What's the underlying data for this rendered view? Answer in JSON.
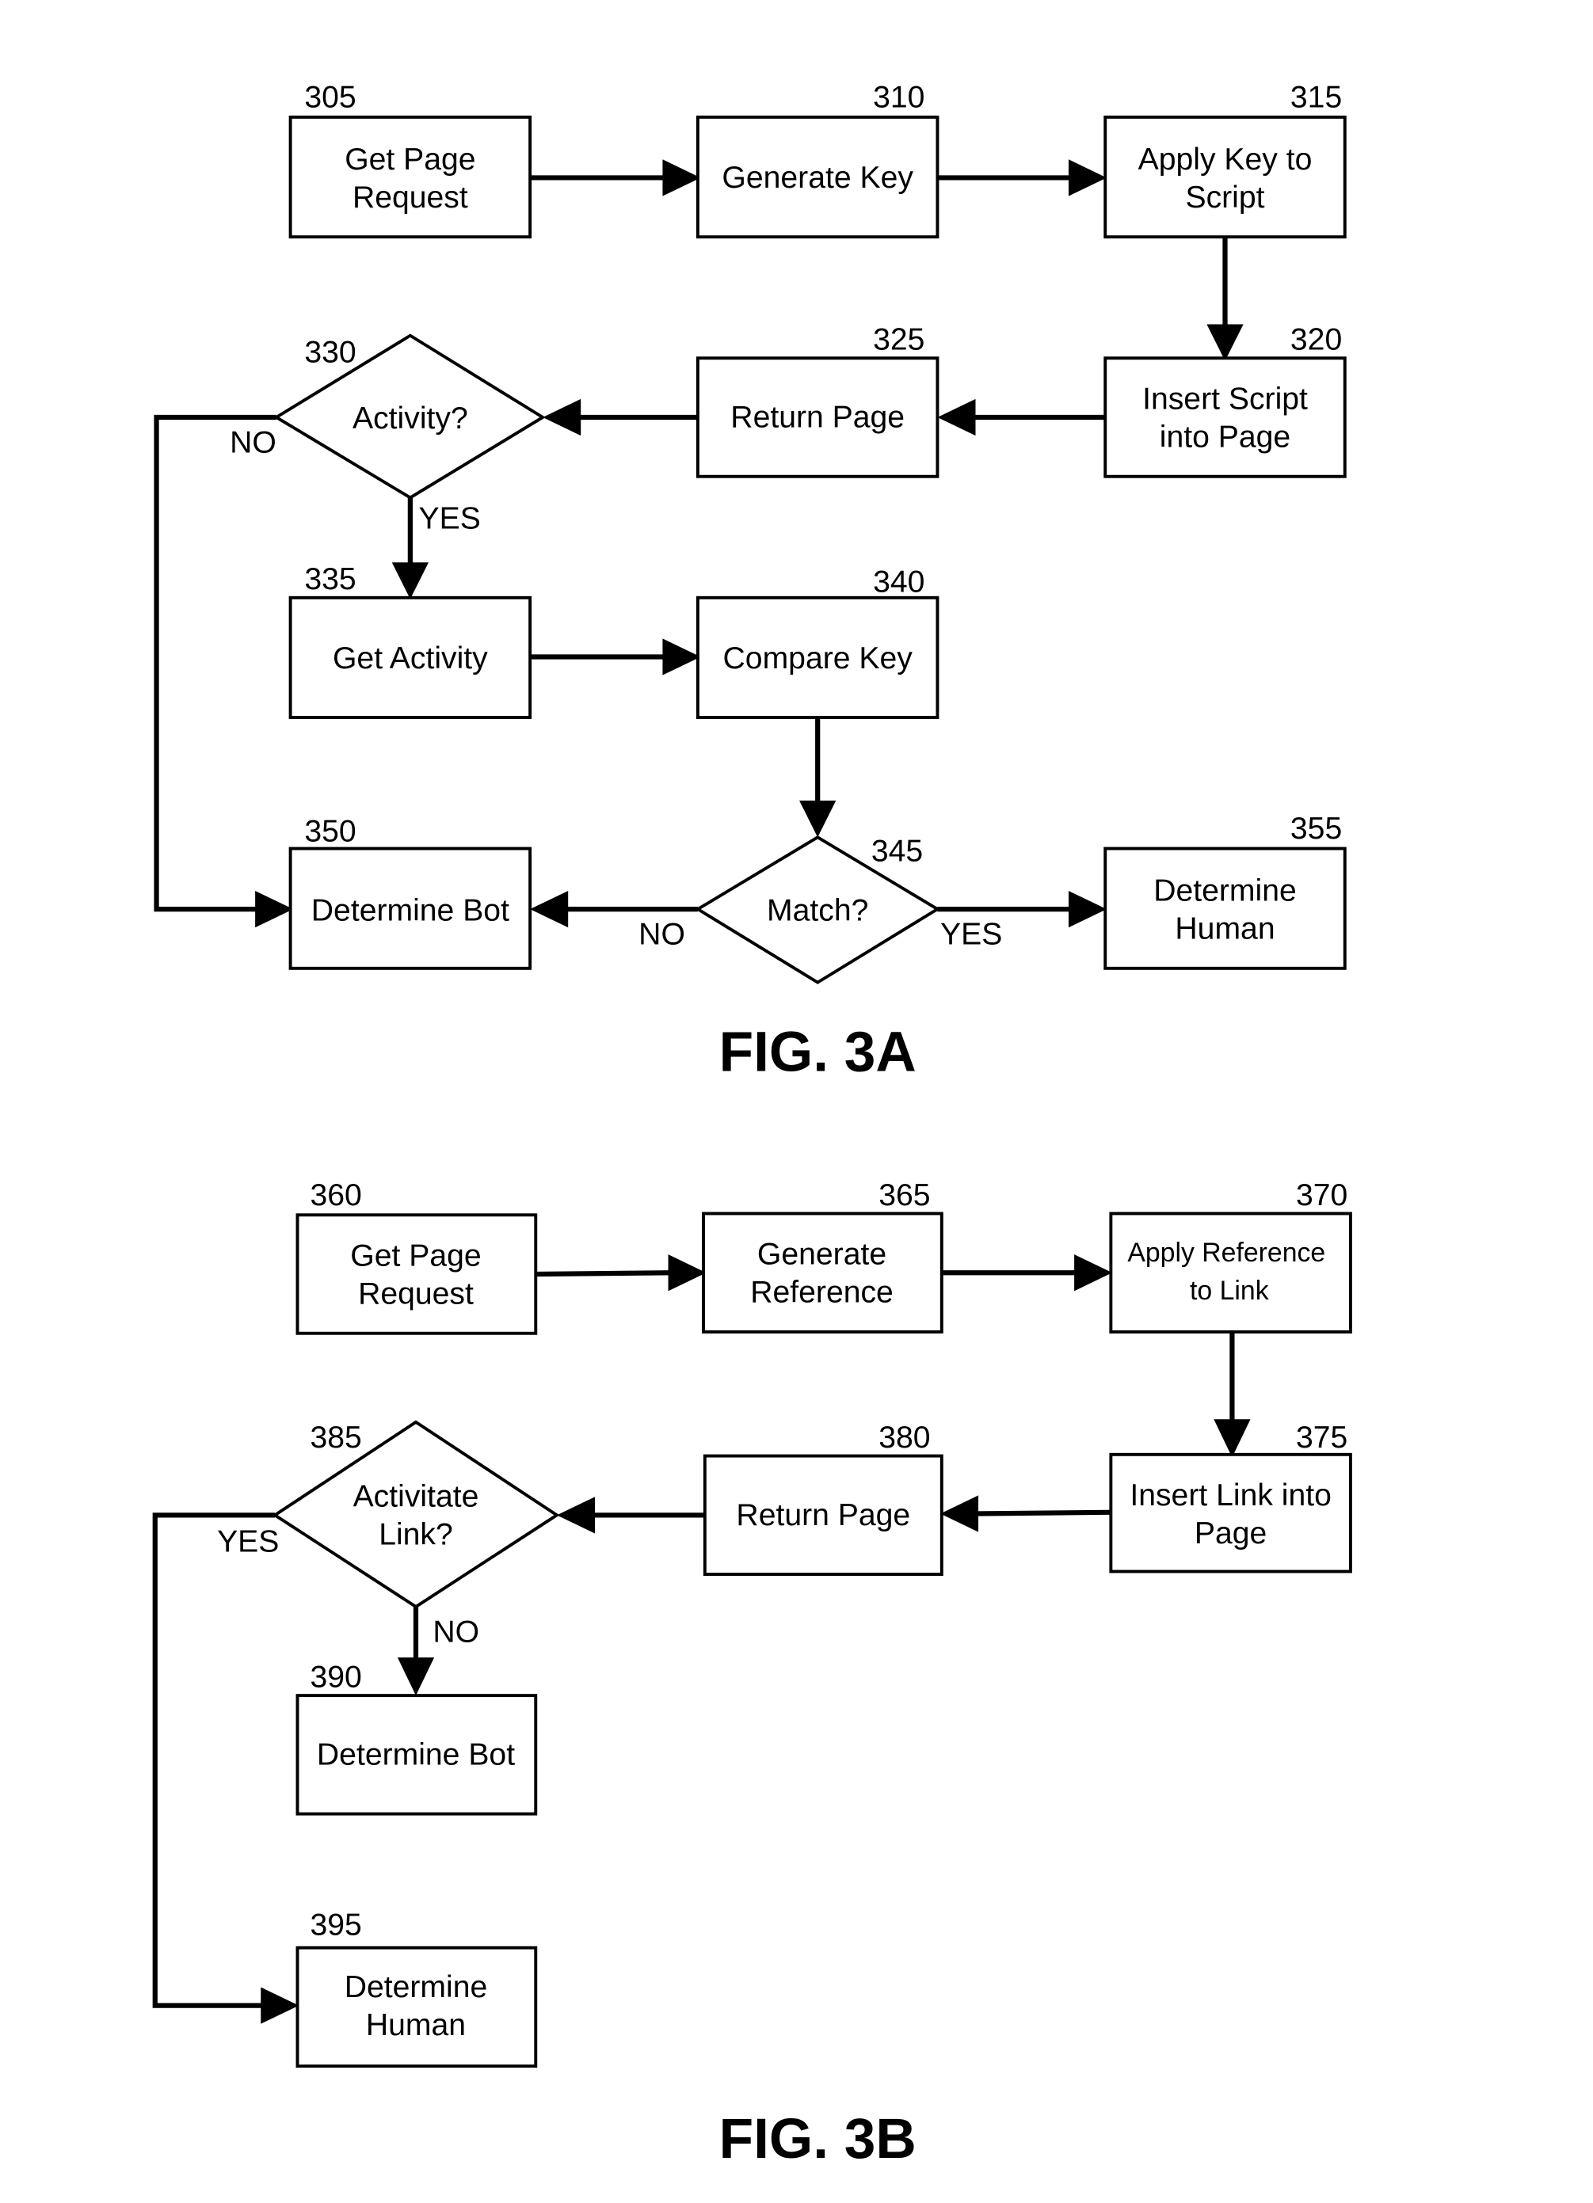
{
  "fig3a": {
    "caption": "FIG. 3A",
    "nodes": {
      "n305": {
        "ref": "305",
        "lines": [
          "Get Page",
          "Request"
        ]
      },
      "n310": {
        "ref": "310",
        "lines": [
          "Generate Key"
        ]
      },
      "n315": {
        "ref": "315",
        "lines": [
          "Apply Key to",
          "Script"
        ]
      },
      "n320": {
        "ref": "320",
        "lines": [
          "Insert Script",
          "into Page"
        ]
      },
      "n325": {
        "ref": "325",
        "lines": [
          "Return Page"
        ]
      },
      "n330": {
        "ref": "330",
        "lines": [
          "Activity?"
        ]
      },
      "n335": {
        "ref": "335",
        "lines": [
          "Get Activity"
        ]
      },
      "n340": {
        "ref": "340",
        "lines": [
          "Compare Key"
        ]
      },
      "n345": {
        "ref": "345",
        "lines": [
          "Match?"
        ]
      },
      "n350": {
        "ref": "350",
        "lines": [
          "Determine Bot"
        ]
      },
      "n355": {
        "ref": "355",
        "lines": [
          "Determine",
          "Human"
        ]
      }
    },
    "labels": {
      "no330": "NO",
      "yes330": "YES",
      "no345": "NO",
      "yes345": "YES"
    }
  },
  "fig3b": {
    "caption": "FIG. 3B",
    "nodes": {
      "n360": {
        "ref": "360",
        "lines": [
          "Get Page",
          "Request"
        ]
      },
      "n365": {
        "ref": "365",
        "lines": [
          "Generate",
          "Reference"
        ]
      },
      "n370": {
        "ref": "370",
        "lines": [
          "Apply Reference",
          "to Link"
        ]
      },
      "n375": {
        "ref": "375",
        "lines": [
          "Insert Link into",
          "Page"
        ]
      },
      "n380": {
        "ref": "380",
        "lines": [
          "Return Page"
        ]
      },
      "n385": {
        "ref": "385",
        "lines": [
          "Activitate",
          "Link?"
        ]
      },
      "n390": {
        "ref": "390",
        "lines": [
          "Determine Bot"
        ]
      },
      "n395": {
        "ref": "395",
        "lines": [
          "Determine",
          "Human"
        ]
      }
    },
    "labels": {
      "yes385": "YES",
      "no385": "NO"
    }
  }
}
